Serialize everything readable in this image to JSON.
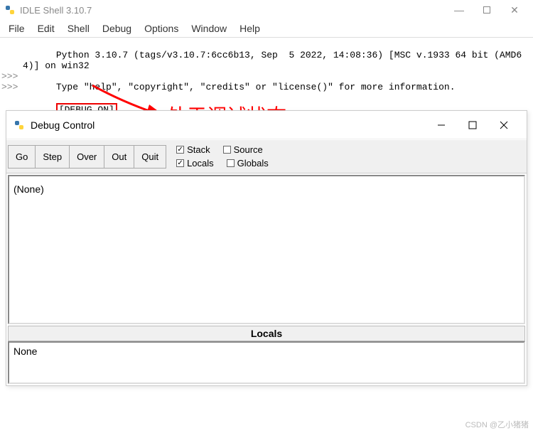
{
  "shell": {
    "title": "IDLE Shell 3.10.7",
    "menu": [
      "File",
      "Edit",
      "Shell",
      "Debug",
      "Options",
      "Window",
      "Help"
    ],
    "gutter": "\n\n\n>>>\n>>>",
    "text_line1": "Python 3.10.7 (tags/v3.10.7:6cc6b13, Sep  5 2022, 14:08:36) [MSC v.1933 64 bit (AMD64)] on win32",
    "text_line2": "Type \"help\", \"copyright\", \"credits\" or \"license()\" for more information.",
    "debug_on": "[DEBUG ON]"
  },
  "annotation": {
    "text": "处于调试状态"
  },
  "debug": {
    "title": "Debug Control",
    "buttons": [
      "Go",
      "Step",
      "Over",
      "Out",
      "Quit"
    ],
    "checks": {
      "stack": "Stack",
      "source": "Source",
      "locals": "Locals",
      "globals": "Globals"
    },
    "pane_text": "(None)",
    "locals_header": "Locals",
    "locals_value": "None"
  },
  "watermark": "CSDN @乙小猪猪"
}
